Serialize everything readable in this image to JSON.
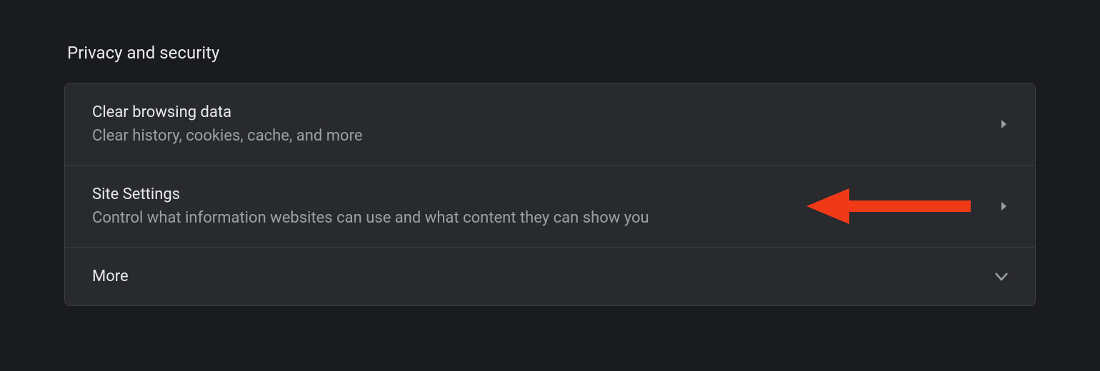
{
  "section": {
    "title": "Privacy and security"
  },
  "rows": [
    {
      "title": "Clear browsing data",
      "subtitle": "Clear history, cookies, cache, and more"
    },
    {
      "title": "Site Settings",
      "subtitle": "Control what information websites can use and what content they can show you"
    },
    {
      "title": "More"
    }
  ]
}
